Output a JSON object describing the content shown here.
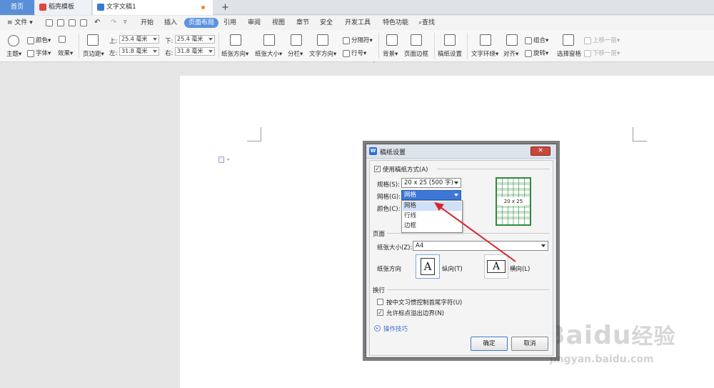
{
  "tabs": {
    "home": "首页",
    "template": "稻壳模板",
    "document": "文字文稿1",
    "new_tab": "+"
  },
  "menu": {
    "file": "文件",
    "items": [
      "开始",
      "插入",
      "页面布局",
      "引用",
      "审阅",
      "视图",
      "章节",
      "安全",
      "开发工具",
      "特色功能"
    ],
    "search": "查找"
  },
  "ribbon": {
    "theme": "主题",
    "colors": "颜色",
    "fonts": "字体",
    "effects": "效果",
    "margins": "页边距",
    "top_label": "上:",
    "top_value": "25.4 毫米",
    "bottom_label": "下:",
    "bottom_value": "25.4 毫米",
    "left_label": "左:",
    "left_value": "31.8 毫米",
    "right_label": "右:",
    "right_value": "31.8 毫米",
    "orientation": "纸张方向",
    "paper_size": "纸张大小",
    "columns": "分栏",
    "text_direction": "文字方向",
    "breaks": "分隔符",
    "line_numbers": "行号",
    "background": "背景",
    "page_border": "页面边框",
    "manuscript_settings": "稿纸设置",
    "text_wrap": "文字环绕",
    "align": "对齐",
    "group": "组合",
    "rotate": "旋转",
    "selection_pane": "选择窗格",
    "bring_forward": "上移一层",
    "send_backward": "下移一层"
  },
  "dialog": {
    "title": "稿纸设置",
    "use_manuscript": "使用稿纸方式(A)",
    "spec_label": "规格(S):",
    "spec_value": "20 x 25 (500 字)",
    "grid_label": "网格(G):",
    "grid_value": "网格",
    "color_label": "颜色(C):",
    "grid_options": [
      "网格",
      "行线",
      "边框"
    ],
    "preview_label": "20 x 25",
    "page_section": "页面",
    "paper_size_label": "纸张大小(Z):",
    "paper_size_value": "A4",
    "orientation_label": "纸张方向",
    "portrait": "纵向(T)",
    "landscape": "横向(L)",
    "orientation_glyph": "A",
    "linebreak_section": "换行",
    "opt_chinese_rules": "按中文习惯控制首尾字符(U)",
    "opt_punctuation": "允许标点溢出边界(N)",
    "tips": "操作技巧",
    "ok": "确定",
    "cancel": "取消"
  },
  "watermark": {
    "brand": "Baidu",
    "brand_cn": "经验",
    "url": "jingyan.baidu.com"
  },
  "colors": {
    "accent": "#5b93e0",
    "arrow": "#d9222a",
    "grid_green": "#2f8a3a"
  }
}
